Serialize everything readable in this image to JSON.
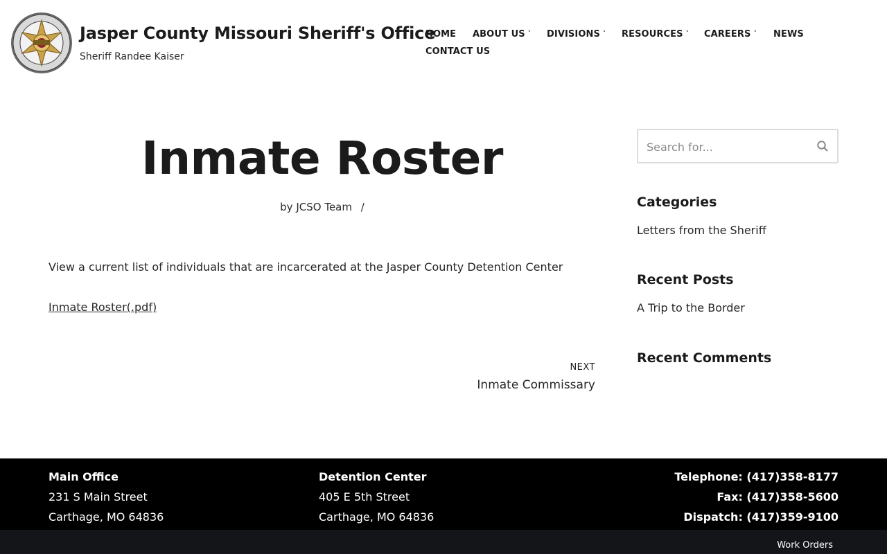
{
  "header": {
    "site_title": "Jasper County Missouri Sheriff's Office",
    "tagline": "Sheriff Randee Kaiser",
    "logo": {
      "ring_text_top": "JASPER COUNTY",
      "ring_text_bottom": "SHERIFF'S OFFICE",
      "center_text": "SHERIFF",
      "icon": "sheriff-star-badge"
    }
  },
  "nav": {
    "items": [
      {
        "label": "HOME",
        "has_dropdown": false
      },
      {
        "label": "ABOUT US",
        "has_dropdown": true
      },
      {
        "label": "DIVISIONS",
        "has_dropdown": true
      },
      {
        "label": "RESOURCES",
        "has_dropdown": true
      },
      {
        "label": "CAREERS",
        "has_dropdown": true
      },
      {
        "label": "NEWS",
        "has_dropdown": false
      },
      {
        "label": "CONTACT US",
        "has_dropdown": false
      }
    ],
    "caret": "˅"
  },
  "post": {
    "title": "Inmate Roster",
    "meta_prefix": "by",
    "author": "JCSO Team",
    "meta_separator": "/",
    "body": "View a current list of individuals that are incarcerated at the Jasper County Detention Center",
    "link_text": "Inmate Roster(.pdf)",
    "next_label": "NEXT",
    "next_title": "Inmate Commissary"
  },
  "sidebar": {
    "search_placeholder": "Search for...",
    "search_icon": "search-icon",
    "categories_title": "Categories",
    "categories": [
      "Letters from the Sheriff"
    ],
    "recent_posts_title": "Recent Posts",
    "recent_posts": [
      "A Trip to the Border"
    ],
    "recent_comments_title": "Recent Comments"
  },
  "footer": {
    "main_office": {
      "heading": "Main Office",
      "street": "231 S Main Street",
      "city": "Carthage, MO 64836"
    },
    "detention_center": {
      "heading": "Detention Center",
      "street": "405 E 5th Street",
      "city": "Carthage, MO 64836"
    },
    "contacts": {
      "telephone": "Telephone: (417)358-8177",
      "fax": "Fax: (417)358-5600",
      "dispatch": "Dispatch: (417)359-9100"
    },
    "work_orders": "Work Orders"
  },
  "colors": {
    "text": "#272626",
    "heading": "#1b1b1b",
    "footer_bg": "#000000",
    "footer_bottom_bg": "#141518",
    "badge_gold": "#c9a24a",
    "badge_ring": "#5a5a5a"
  }
}
